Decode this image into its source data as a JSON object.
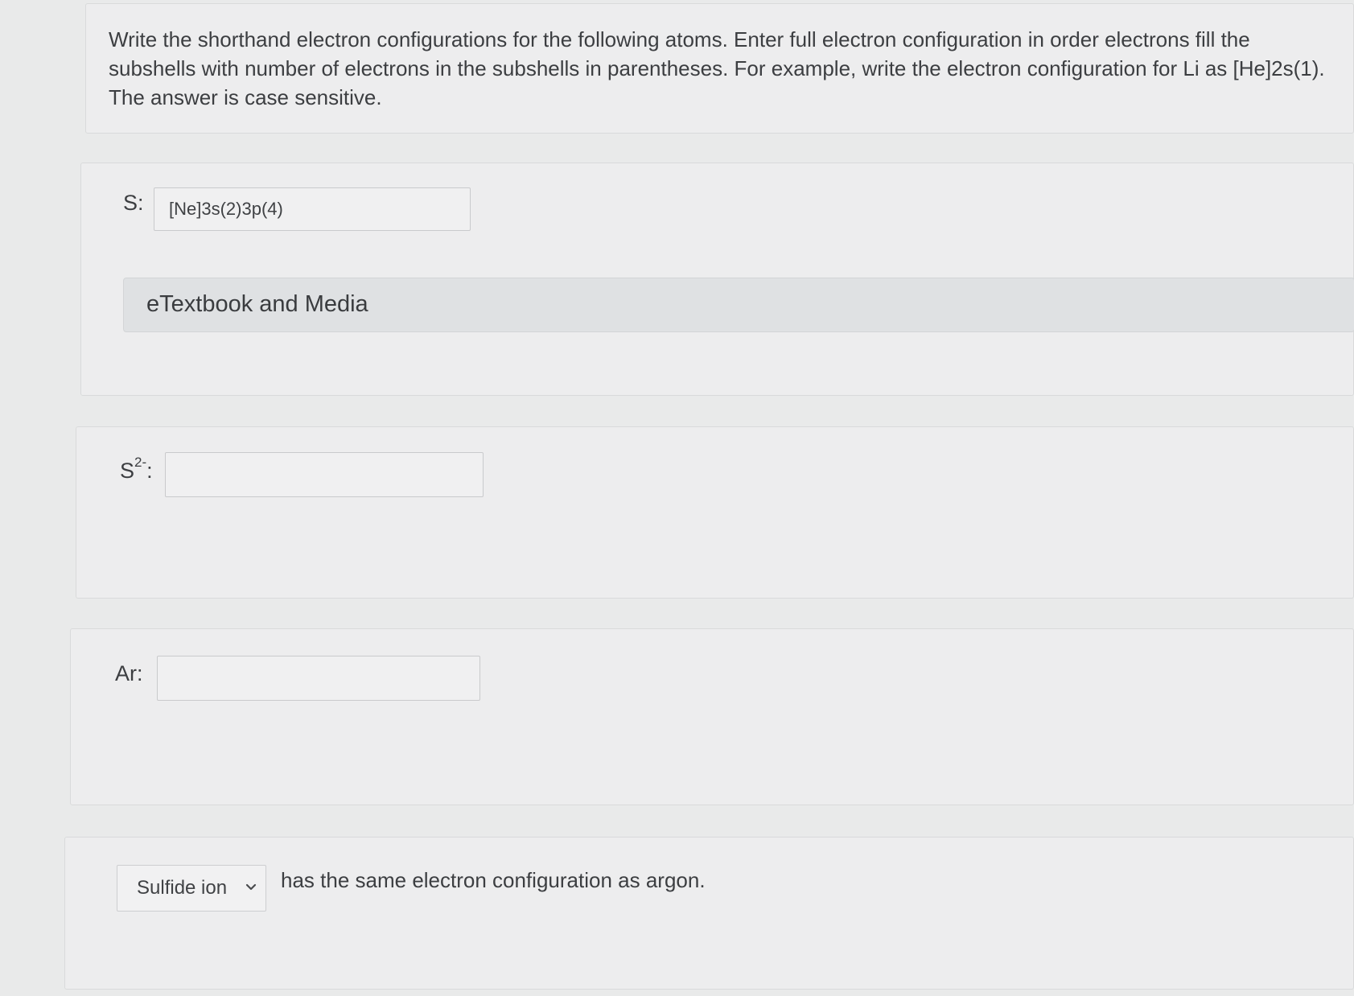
{
  "instructions": {
    "text": "Write the shorthand electron configurations for the following atoms. Enter full electron configuration in order electrons fill the subshells with number of electrons in the subshells in parentheses. For example, write the electron configuration for Li as [He]2s(1). The answer is case sensitive."
  },
  "questions": {
    "s": {
      "label": "S:",
      "value": "[Ne]3s(2)3p(4)"
    },
    "s2": {
      "label_base": "S",
      "label_sup": "2-",
      "label_colon": ":",
      "value": ""
    },
    "ar": {
      "label": "Ar:",
      "value": ""
    }
  },
  "etextbook": {
    "label": "eTextbook and Media"
  },
  "dropdown": {
    "selected": "Sulfide ion",
    "icon": "chevron-down-icon"
  },
  "sentence": {
    "text": "has the same electron configuration as argon."
  }
}
